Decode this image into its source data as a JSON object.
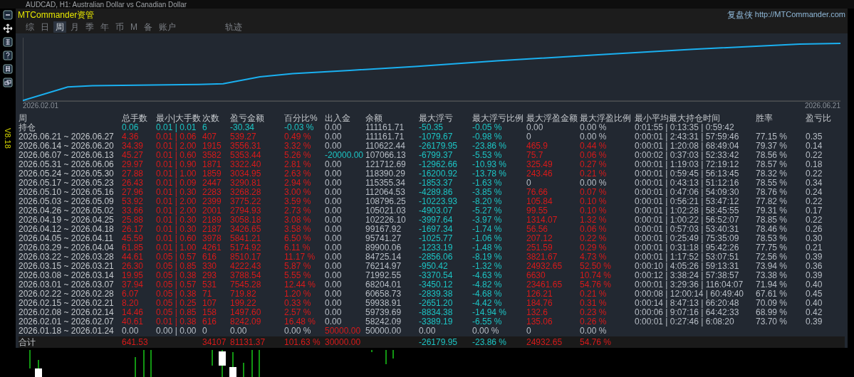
{
  "window": {
    "title": "AUDCAD, H1:  Australian Dollar vs Canadian Dollar"
  },
  "version": "V8.18",
  "header": {
    "brand": "MTCommander资管",
    "site_label": "复盘侠",
    "site_url": "http://MTCommander.com"
  },
  "tabs": [
    {
      "label": "综",
      "selected": false
    },
    {
      "label": "日",
      "selected": false
    },
    {
      "label": "周",
      "selected": true
    },
    {
      "label": "月",
      "selected": false
    },
    {
      "label": "季",
      "selected": false
    },
    {
      "label": "年",
      "selected": false
    },
    {
      "label": "币",
      "selected": false
    },
    {
      "label": "M",
      "selected": false
    },
    {
      "label": "备",
      "selected": false
    },
    {
      "label": "账户",
      "selected": false
    },
    {
      "label": "轨迹",
      "selected": false
    }
  ],
  "chart": {
    "start_label": "2026.02.01",
    "end_label": "2026.06.21"
  },
  "table": {
    "corner": "周",
    "columns": [
      "总手数",
      "最小|大手数",
      "次数",
      "盈亏金额",
      "百分比%",
      "出入金",
      "余额",
      "最大浮亏",
      "最大浮亏比例",
      "最大浮盈金额",
      "最大浮盈比例",
      "最小平均最大持仓时间",
      "胜率",
      "盈亏比"
    ],
    "position_row": {
      "label": "持仓",
      "cells": [
        {
          "text": "0.06",
          "color": "#1cc4c4"
        },
        {
          "text": "0.01 | 0.01",
          "color": "#1cc4c4"
        },
        {
          "text": "6",
          "color": "#1cc4c4"
        },
        {
          "text": "-30.34",
          "color": "#1cc4c4"
        },
        {
          "text": "-0.03 %",
          "color": "#1cc4c4"
        },
        {
          "text": "0.00",
          "color": "#b8bec6"
        },
        {
          "text": "111161.71",
          "color": "#b8bec6"
        },
        {
          "text": "-50.35",
          "color": "#1cc4c4"
        },
        {
          "text": "-0.05 %",
          "color": "#1cc4c4"
        },
        {
          "text": "0.00",
          "color": "#b8bec6"
        },
        {
          "text": "0.00 %",
          "color": "#b8bec6"
        },
        {
          "text": "0:01:55 | 0:13:35 | 0:59:42",
          "color": "#b8bec6"
        }
      ]
    },
    "rows": [
      {
        "label": "2026.06.21 ~ 2026.06.27",
        "cells": [
          {
            "text": "4.36",
            "color": "#d81a1a"
          },
          {
            "text": "0.01 | 0.06",
            "color": "#d81a1a"
          },
          {
            "text": "407",
            "color": "#d81a1a"
          },
          {
            "text": "539.27",
            "color": "#d81a1a"
          },
          {
            "text": "0.49 %",
            "color": "#d81a1a"
          },
          {
            "text": "0.00",
            "color": "#b8bec6"
          },
          {
            "text": "111161.71",
            "color": "#b8bec6"
          },
          {
            "text": "-1079.67",
            "color": "#1cc4c4"
          },
          {
            "text": "-0.98 %",
            "color": "#1cc4c4"
          },
          {
            "text": "0",
            "color": "#b8bec6"
          },
          {
            "text": "0.00 %",
            "color": "#b8bec6"
          },
          {
            "text": "0:00:01 | 2:43:31 | 57:59:46",
            "color": "#b8bec6"
          },
          {
            "text": "77.15 %",
            "color": "#b8bec6"
          },
          {
            "text": "0.35",
            "color": "#b8bec6"
          }
        ]
      },
      {
        "label": "2026.06.14 ~ 2026.06.20",
        "cells": [
          {
            "text": "34.39",
            "color": "#d81a1a"
          },
          {
            "text": "0.01 | 2.00",
            "color": "#d81a1a"
          },
          {
            "text": "1915",
            "color": "#d81a1a"
          },
          {
            "text": "3556.31",
            "color": "#d81a1a"
          },
          {
            "text": "3.32 %",
            "color": "#d81a1a"
          },
          {
            "text": "0.00",
            "color": "#b8bec6"
          },
          {
            "text": "110622.44",
            "color": "#b8bec6"
          },
          {
            "text": "-26179.95",
            "color": "#1cc4c4"
          },
          {
            "text": "-23.86 %",
            "color": "#1cc4c4"
          },
          {
            "text": "465.9",
            "color": "#d81a1a"
          },
          {
            "text": "0.44 %",
            "color": "#d81a1a"
          },
          {
            "text": "0:00:01 | 1:20:08 | 68:49:04",
            "color": "#b8bec6"
          },
          {
            "text": "79.37 %",
            "color": "#b8bec6"
          },
          {
            "text": "0.14",
            "color": "#b8bec6"
          }
        ]
      },
      {
        "label": "2026.06.07 ~ 2026.06.13",
        "cells": [
          {
            "text": "45.27",
            "color": "#d81a1a"
          },
          {
            "text": "0.01 | 0.60",
            "color": "#d81a1a"
          },
          {
            "text": "3582",
            "color": "#d81a1a"
          },
          {
            "text": "5353.44",
            "color": "#d81a1a"
          },
          {
            "text": "5.26 %",
            "color": "#d81a1a"
          },
          {
            "text": "-20000.00",
            "color": "#1cc4c4"
          },
          {
            "text": "107066.13",
            "color": "#b8bec6"
          },
          {
            "text": "-6799.37",
            "color": "#1cc4c4"
          },
          {
            "text": "-5.53 %",
            "color": "#1cc4c4"
          },
          {
            "text": "75.7",
            "color": "#d81a1a"
          },
          {
            "text": "0.06 %",
            "color": "#d81a1a"
          },
          {
            "text": "0:00:02 | 0:37:03 | 52:33:42",
            "color": "#b8bec6"
          },
          {
            "text": "78.56 %",
            "color": "#b8bec6"
          },
          {
            "text": "0.22",
            "color": "#b8bec6"
          }
        ]
      },
      {
        "label": "2026.05.31 ~ 2026.06.06",
        "cells": [
          {
            "text": "29.97",
            "color": "#d81a1a"
          },
          {
            "text": "0.01 | 0.90",
            "color": "#d81a1a"
          },
          {
            "text": "1871",
            "color": "#d81a1a"
          },
          {
            "text": "3322.40",
            "color": "#d81a1a"
          },
          {
            "text": "2.81 %",
            "color": "#d81a1a"
          },
          {
            "text": "0.00",
            "color": "#b8bec6"
          },
          {
            "text": "121712.69",
            "color": "#b8bec6"
          },
          {
            "text": "-12962.66",
            "color": "#1cc4c4"
          },
          {
            "text": "-10.93 %",
            "color": "#1cc4c4"
          },
          {
            "text": "325.49",
            "color": "#d81a1a"
          },
          {
            "text": "0.27 %",
            "color": "#d81a1a"
          },
          {
            "text": "0:00:01 | 1:19:03 | 72:19:12",
            "color": "#b8bec6"
          },
          {
            "text": "78.57 %",
            "color": "#b8bec6"
          },
          {
            "text": "0.18",
            "color": "#b8bec6"
          }
        ]
      },
      {
        "label": "2026.05.24 ~ 2026.05.30",
        "cells": [
          {
            "text": "27.88",
            "color": "#d81a1a"
          },
          {
            "text": "0.01 | 1.00",
            "color": "#d81a1a"
          },
          {
            "text": "1859",
            "color": "#d81a1a"
          },
          {
            "text": "3034.95",
            "color": "#d81a1a"
          },
          {
            "text": "2.63 %",
            "color": "#d81a1a"
          },
          {
            "text": "0.00",
            "color": "#b8bec6"
          },
          {
            "text": "118390.29",
            "color": "#b8bec6"
          },
          {
            "text": "-16200.92",
            "color": "#1cc4c4"
          },
          {
            "text": "-13.78 %",
            "color": "#1cc4c4"
          },
          {
            "text": "243.46",
            "color": "#d81a1a"
          },
          {
            "text": "0.21 %",
            "color": "#d81a1a"
          },
          {
            "text": "0:00:01 | 0:59:45 | 56:13:45",
            "color": "#b8bec6"
          },
          {
            "text": "78.32 %",
            "color": "#b8bec6"
          },
          {
            "text": "0.22",
            "color": "#b8bec6"
          }
        ]
      },
      {
        "label": "2026.05.17 ~ 2026.05.23",
        "cells": [
          {
            "text": "26.43",
            "color": "#d81a1a"
          },
          {
            "text": "0.01 | 0.09",
            "color": "#d81a1a"
          },
          {
            "text": "2447",
            "color": "#d81a1a"
          },
          {
            "text": "3290.81",
            "color": "#d81a1a"
          },
          {
            "text": "2.94 %",
            "color": "#d81a1a"
          },
          {
            "text": "0.00",
            "color": "#b8bec6"
          },
          {
            "text": "115355.34",
            "color": "#b8bec6"
          },
          {
            "text": "-1853.37",
            "color": "#1cc4c4"
          },
          {
            "text": "-1.63 %",
            "color": "#1cc4c4"
          },
          {
            "text": "0",
            "color": "#b8bec6"
          },
          {
            "text": "0.00 %",
            "color": "#b8bec6"
          },
          {
            "text": "0:00:01 | 0:43:13 | 51:12:16",
            "color": "#b8bec6"
          },
          {
            "text": "78.55 %",
            "color": "#b8bec6"
          },
          {
            "text": "0.34",
            "color": "#b8bec6"
          }
        ]
      },
      {
        "label": "2026.05.10 ~ 2026.05.16",
        "cells": [
          {
            "text": "27.96",
            "color": "#d81a1a"
          },
          {
            "text": "0.01 | 0.30",
            "color": "#d81a1a"
          },
          {
            "text": "2283",
            "color": "#d81a1a"
          },
          {
            "text": "3268.28",
            "color": "#d81a1a"
          },
          {
            "text": "3.00 %",
            "color": "#d81a1a"
          },
          {
            "text": "0.00",
            "color": "#b8bec6"
          },
          {
            "text": "112064.53",
            "color": "#b8bec6"
          },
          {
            "text": "-4289.86",
            "color": "#1cc4c4"
          },
          {
            "text": "-3.85 %",
            "color": "#1cc4c4"
          },
          {
            "text": "76.66",
            "color": "#d81a1a"
          },
          {
            "text": "0.07 %",
            "color": "#d81a1a"
          },
          {
            "text": "0:00:01 | 0:47:06 | 54:09:30",
            "color": "#b8bec6"
          },
          {
            "text": "78.76 %",
            "color": "#b8bec6"
          },
          {
            "text": "0.24",
            "color": "#b8bec6"
          }
        ]
      },
      {
        "label": "2026.05.03 ~ 2026.05.09",
        "cells": [
          {
            "text": "53.92",
            "color": "#d81a1a"
          },
          {
            "text": "0.01 | 2.00",
            "color": "#d81a1a"
          },
          {
            "text": "2399",
            "color": "#d81a1a"
          },
          {
            "text": "3775.22",
            "color": "#d81a1a"
          },
          {
            "text": "3.59 %",
            "color": "#d81a1a"
          },
          {
            "text": "0.00",
            "color": "#b8bec6"
          },
          {
            "text": "108796.25",
            "color": "#b8bec6"
          },
          {
            "text": "-10223.93",
            "color": "#1cc4c4"
          },
          {
            "text": "-8.20 %",
            "color": "#1cc4c4"
          },
          {
            "text": "105.84",
            "color": "#d81a1a"
          },
          {
            "text": "0.10 %",
            "color": "#d81a1a"
          },
          {
            "text": "0:00:01 | 0:56:21 | 53:47:12",
            "color": "#b8bec6"
          },
          {
            "text": "77.82 %",
            "color": "#b8bec6"
          },
          {
            "text": "0.22",
            "color": "#b8bec6"
          }
        ]
      },
      {
        "label": "2026.04.26 ~ 2026.05.02",
        "cells": [
          {
            "text": "33.66",
            "color": "#d81a1a"
          },
          {
            "text": "0.01 | 2.00",
            "color": "#d81a1a"
          },
          {
            "text": "2001",
            "color": "#d81a1a"
          },
          {
            "text": "2794.93",
            "color": "#d81a1a"
          },
          {
            "text": "2.73 %",
            "color": "#d81a1a"
          },
          {
            "text": "0.00",
            "color": "#b8bec6"
          },
          {
            "text": "105021.03",
            "color": "#b8bec6"
          },
          {
            "text": "-4903.07",
            "color": "#1cc4c4"
          },
          {
            "text": "-5.27 %",
            "color": "#1cc4c4"
          },
          {
            "text": "99.55",
            "color": "#d81a1a"
          },
          {
            "text": "0.10 %",
            "color": "#d81a1a"
          },
          {
            "text": "0:00:01 | 1:02:28 | 58:45:55",
            "color": "#b8bec6"
          },
          {
            "text": "79.31 %",
            "color": "#b8bec6"
          },
          {
            "text": "0.17",
            "color": "#b8bec6"
          }
        ]
      },
      {
        "label": "2026.04.19 ~ 2026.04.25",
        "cells": [
          {
            "text": "25.88",
            "color": "#d81a1a"
          },
          {
            "text": "0.01 | 0.30",
            "color": "#d81a1a"
          },
          {
            "text": "2189",
            "color": "#d81a1a"
          },
          {
            "text": "3058.18",
            "color": "#d81a1a"
          },
          {
            "text": "3.08 %",
            "color": "#d81a1a"
          },
          {
            "text": "0.00",
            "color": "#b8bec6"
          },
          {
            "text": "102226.10",
            "color": "#b8bec6"
          },
          {
            "text": "-3997.64",
            "color": "#1cc4c4"
          },
          {
            "text": "-3.97 %",
            "color": "#1cc4c4"
          },
          {
            "text": "1314.07",
            "color": "#d81a1a"
          },
          {
            "text": "1.32 %",
            "color": "#d81a1a"
          },
          {
            "text": "0:00:01 | 1:00:22 | 56:52:07",
            "color": "#b8bec6"
          },
          {
            "text": "78.85 %",
            "color": "#b8bec6"
          },
          {
            "text": "0.22",
            "color": "#b8bec6"
          }
        ]
      },
      {
        "label": "2026.04.12 ~ 2026.04.18",
        "cells": [
          {
            "text": "26.17",
            "color": "#d81a1a"
          },
          {
            "text": "0.01 | 0.30",
            "color": "#d81a1a"
          },
          {
            "text": "2187",
            "color": "#d81a1a"
          },
          {
            "text": "3426.65",
            "color": "#d81a1a"
          },
          {
            "text": "3.58 %",
            "color": "#d81a1a"
          },
          {
            "text": "0.00",
            "color": "#b8bec6"
          },
          {
            "text": "99167.92",
            "color": "#b8bec6"
          },
          {
            "text": "-1697.34",
            "color": "#1cc4c4"
          },
          {
            "text": "-1.74 %",
            "color": "#1cc4c4"
          },
          {
            "text": "56.56",
            "color": "#d81a1a"
          },
          {
            "text": "0.06 %",
            "color": "#d81a1a"
          },
          {
            "text": "0:00:01 | 0:57:03 | 53:40:31",
            "color": "#b8bec6"
          },
          {
            "text": "78.46 %",
            "color": "#b8bec6"
          },
          {
            "text": "0.26",
            "color": "#b8bec6"
          }
        ]
      },
      {
        "label": "2026.04.05 ~ 2026.04.11",
        "cells": [
          {
            "text": "45.59",
            "color": "#d81a1a"
          },
          {
            "text": "0.01 | 0.60",
            "color": "#d81a1a"
          },
          {
            "text": "3978",
            "color": "#d81a1a"
          },
          {
            "text": "5841.21",
            "color": "#d81a1a"
          },
          {
            "text": "6.50 %",
            "color": "#d81a1a"
          },
          {
            "text": "0.00",
            "color": "#b8bec6"
          },
          {
            "text": "95741.27",
            "color": "#b8bec6"
          },
          {
            "text": "-1025.77",
            "color": "#1cc4c4"
          },
          {
            "text": "-1.06 %",
            "color": "#1cc4c4"
          },
          {
            "text": "207.12",
            "color": "#d81a1a"
          },
          {
            "text": "0.22 %",
            "color": "#d81a1a"
          },
          {
            "text": "0:00:01 | 0:25:49 | 75:35:09",
            "color": "#b8bec6"
          },
          {
            "text": "78.53 %",
            "color": "#b8bec6"
          },
          {
            "text": "0.30",
            "color": "#b8bec6"
          }
        ]
      },
      {
        "label": "2026.03.29 ~ 2026.04.04",
        "cells": [
          {
            "text": "61.85",
            "color": "#d81a1a"
          },
          {
            "text": "0.01 | 1.00",
            "color": "#d81a1a"
          },
          {
            "text": "4261",
            "color": "#d81a1a"
          },
          {
            "text": "5174.92",
            "color": "#d81a1a"
          },
          {
            "text": "6.11 %",
            "color": "#d81a1a"
          },
          {
            "text": "0.00",
            "color": "#b8bec6"
          },
          {
            "text": "89900.06",
            "color": "#b8bec6"
          },
          {
            "text": "-1233.19",
            "color": "#1cc4c4"
          },
          {
            "text": "-1.48 %",
            "color": "#1cc4c4"
          },
          {
            "text": "251.59",
            "color": "#d81a1a"
          },
          {
            "text": "0.29 %",
            "color": "#d81a1a"
          },
          {
            "text": "0:00:01 | 0:31:18 | 95:42:26",
            "color": "#b8bec6"
          },
          {
            "text": "77.75 %",
            "color": "#b8bec6"
          },
          {
            "text": "0.21",
            "color": "#b8bec6"
          }
        ]
      },
      {
        "label": "2026.03.22 ~ 2026.03.28",
        "cells": [
          {
            "text": "44.61",
            "color": "#d81a1a"
          },
          {
            "text": "0.05 | 0.57",
            "color": "#d81a1a"
          },
          {
            "text": "616",
            "color": "#d81a1a"
          },
          {
            "text": "8510.17",
            "color": "#d81a1a"
          },
          {
            "text": "11.17 %",
            "color": "#d81a1a"
          },
          {
            "text": "0.00",
            "color": "#b8bec6"
          },
          {
            "text": "84725.14",
            "color": "#b8bec6"
          },
          {
            "text": "-2856.06",
            "color": "#1cc4c4"
          },
          {
            "text": "-8.19 %",
            "color": "#1cc4c4"
          },
          {
            "text": "3821.67",
            "color": "#d81a1a"
          },
          {
            "text": "4.73 %",
            "color": "#d81a1a"
          },
          {
            "text": "0:00:01 | 1:17:52 | 53:07:51",
            "color": "#b8bec6"
          },
          {
            "text": "72.56 %",
            "color": "#b8bec6"
          },
          {
            "text": "0.39",
            "color": "#b8bec6"
          }
        ]
      },
      {
        "label": "2026.03.15 ~ 2026.03.21",
        "cells": [
          {
            "text": "26.30",
            "color": "#d81a1a"
          },
          {
            "text": "0.05 | 0.85",
            "color": "#d81a1a"
          },
          {
            "text": "330",
            "color": "#d81a1a"
          },
          {
            "text": "4222.43",
            "color": "#d81a1a"
          },
          {
            "text": "5.87 %",
            "color": "#d81a1a"
          },
          {
            "text": "0.00",
            "color": "#b8bec6"
          },
          {
            "text": "76214.97",
            "color": "#b8bec6"
          },
          {
            "text": "-950.42",
            "color": "#1cc4c4"
          },
          {
            "text": "-1.32 %",
            "color": "#1cc4c4"
          },
          {
            "text": "24932.65",
            "color": "#d81a1a"
          },
          {
            "text": "52.50 %",
            "color": "#d81a1a"
          },
          {
            "text": "0:00:10 | 4:05:26 | 59:13:31",
            "color": "#b8bec6"
          },
          {
            "text": "73.94 %",
            "color": "#b8bec6"
          },
          {
            "text": "0.36",
            "color": "#b8bec6"
          }
        ]
      },
      {
        "label": "2026.03.08 ~ 2026.03.14",
        "cells": [
          {
            "text": "19.95",
            "color": "#d81a1a"
          },
          {
            "text": "0.05 | 0.38",
            "color": "#d81a1a"
          },
          {
            "text": "293",
            "color": "#d81a1a"
          },
          {
            "text": "3788.54",
            "color": "#d81a1a"
          },
          {
            "text": "5.55 %",
            "color": "#d81a1a"
          },
          {
            "text": "0.00",
            "color": "#b8bec6"
          },
          {
            "text": "71992.55",
            "color": "#b8bec6"
          },
          {
            "text": "-3370.54",
            "color": "#1cc4c4"
          },
          {
            "text": "-4.63 %",
            "color": "#1cc4c4"
          },
          {
            "text": "6630",
            "color": "#d81a1a"
          },
          {
            "text": "10.74 %",
            "color": "#d81a1a"
          },
          {
            "text": "0:00:12 | 3:38:24 | 57:38:57",
            "color": "#b8bec6"
          },
          {
            "text": "73.38 %",
            "color": "#b8bec6"
          },
          {
            "text": "0.39",
            "color": "#b8bec6"
          }
        ]
      },
      {
        "label": "2026.03.01 ~ 2026.03.07",
        "cells": [
          {
            "text": "37.94",
            "color": "#d81a1a"
          },
          {
            "text": "0.05 | 0.57",
            "color": "#d81a1a"
          },
          {
            "text": "531",
            "color": "#d81a1a"
          },
          {
            "text": "7545.28",
            "color": "#d81a1a"
          },
          {
            "text": "12.44 %",
            "color": "#d81a1a"
          },
          {
            "text": "0.00",
            "color": "#b8bec6"
          },
          {
            "text": "68204.01",
            "color": "#b8bec6"
          },
          {
            "text": "-3450.12",
            "color": "#1cc4c4"
          },
          {
            "text": "-4.82 %",
            "color": "#1cc4c4"
          },
          {
            "text": "23461.65",
            "color": "#d81a1a"
          },
          {
            "text": "54.76 %",
            "color": "#d81a1a"
          },
          {
            "text": "0:00:01 | 3:29:36 | 116:04:07",
            "color": "#b8bec6"
          },
          {
            "text": "71.94 %",
            "color": "#b8bec6"
          },
          {
            "text": "0.40",
            "color": "#b8bec6"
          }
        ]
      },
      {
        "label": "2026.02.22 ~ 2026.02.28",
        "cells": [
          {
            "text": "6.07",
            "color": "#d81a1a"
          },
          {
            "text": "0.05 | 0.38",
            "color": "#d81a1a"
          },
          {
            "text": "71",
            "color": "#d81a1a"
          },
          {
            "text": "719.82",
            "color": "#d81a1a"
          },
          {
            "text": "1.20 %",
            "color": "#d81a1a"
          },
          {
            "text": "0.00",
            "color": "#b8bec6"
          },
          {
            "text": "60658.73",
            "color": "#b8bec6"
          },
          {
            "text": "-2839.38",
            "color": "#1cc4c4"
          },
          {
            "text": "-4.68 %",
            "color": "#1cc4c4"
          },
          {
            "text": "126.21",
            "color": "#d81a1a"
          },
          {
            "text": "0.21 %",
            "color": "#d81a1a"
          },
          {
            "text": "0:00:08 | 12:00:14 | 60:49:40",
            "color": "#b8bec6"
          },
          {
            "text": "67.61 %",
            "color": "#b8bec6"
          },
          {
            "text": "0.45",
            "color": "#b8bec6"
          }
        ]
      },
      {
        "label": "2026.02.15 ~ 2026.02.21",
        "cells": [
          {
            "text": "8.20",
            "color": "#d81a1a"
          },
          {
            "text": "0.05 | 0.25",
            "color": "#d81a1a"
          },
          {
            "text": "107",
            "color": "#d81a1a"
          },
          {
            "text": "199.22",
            "color": "#d81a1a"
          },
          {
            "text": "0.33 %",
            "color": "#d81a1a"
          },
          {
            "text": "0.00",
            "color": "#b8bec6"
          },
          {
            "text": "59938.91",
            "color": "#b8bec6"
          },
          {
            "text": "-2651.20",
            "color": "#1cc4c4"
          },
          {
            "text": "-4.42 %",
            "color": "#1cc4c4"
          },
          {
            "text": "184.76",
            "color": "#d81a1a"
          },
          {
            "text": "0.31 %",
            "color": "#d81a1a"
          },
          {
            "text": "0:00:14 | 8:47:13 | 66:20:48",
            "color": "#b8bec6"
          },
          {
            "text": "70.09 %",
            "color": "#b8bec6"
          },
          {
            "text": "0.40",
            "color": "#b8bec6"
          }
        ]
      },
      {
        "label": "2026.02.08 ~ 2026.02.14",
        "cells": [
          {
            "text": "14.46",
            "color": "#d81a1a"
          },
          {
            "text": "0.05 | 0.85",
            "color": "#d81a1a"
          },
          {
            "text": "158",
            "color": "#d81a1a"
          },
          {
            "text": "1497.60",
            "color": "#d81a1a"
          },
          {
            "text": "2.57 %",
            "color": "#d81a1a"
          },
          {
            "text": "0.00",
            "color": "#b8bec6"
          },
          {
            "text": "59739.69",
            "color": "#b8bec6"
          },
          {
            "text": "-8834.38",
            "color": "#1cc4c4"
          },
          {
            "text": "-14.94 %",
            "color": "#1cc4c4"
          },
          {
            "text": "132.6",
            "color": "#d81a1a"
          },
          {
            "text": "0.23 %",
            "color": "#d81a1a"
          },
          {
            "text": "0:00:06 | 9:07:16 | 64:42:33",
            "color": "#b8bec6"
          },
          {
            "text": "68.99 %",
            "color": "#b8bec6"
          },
          {
            "text": "0.42",
            "color": "#b8bec6"
          }
        ]
      },
      {
        "label": "2026.02.01 ~ 2026.02.07",
        "cells": [
          {
            "text": "40.61",
            "color": "#d81a1a"
          },
          {
            "text": "0.01 | 0.38",
            "color": "#d81a1a"
          },
          {
            "text": "616",
            "color": "#d81a1a"
          },
          {
            "text": "8242.09",
            "color": "#d81a1a"
          },
          {
            "text": "16.48 %",
            "color": "#d81a1a"
          },
          {
            "text": "0.00",
            "color": "#b8bec6"
          },
          {
            "text": "58242.09",
            "color": "#b8bec6"
          },
          {
            "text": "-3389.19",
            "color": "#1cc4c4"
          },
          {
            "text": "-6.55 %",
            "color": "#1cc4c4"
          },
          {
            "text": "135.06",
            "color": "#d81a1a"
          },
          {
            "text": "0.26 %",
            "color": "#d81a1a"
          },
          {
            "text": "0:00:01 | 0:27:46 | 6:08:20",
            "color": "#b8bec6"
          },
          {
            "text": "73.70 %",
            "color": "#b8bec6"
          },
          {
            "text": "0.39",
            "color": "#b8bec6"
          }
        ]
      },
      {
        "label": "2026.01.18 ~ 2026.01.24",
        "cells": [
          {
            "text": "0.00",
            "color": "#b8bec6"
          },
          {
            "text": "0.00 | 0.00",
            "color": "#b8bec6"
          },
          {
            "text": "0",
            "color": "#b8bec6"
          },
          {
            "text": "0.00",
            "color": "#b8bec6"
          },
          {
            "text": "0.00 %",
            "color": "#b8bec6"
          },
          {
            "text": "50000.00",
            "color": "#d81a1a"
          },
          {
            "text": "50000.00",
            "color": "#b8bec6"
          },
          {
            "text": "0.00",
            "color": "#b8bec6"
          },
          {
            "text": "0.00 %",
            "color": "#b8bec6"
          },
          {
            "text": "0",
            "color": "#b8bec6"
          },
          {
            "text": "0.00 %",
            "color": "#b8bec6"
          }
        ]
      }
    ],
    "total_row": {
      "label": "合计",
      "cells": [
        {
          "kind": "value",
          "text": "641.53",
          "color": "#d81a1a"
        },
        {
          "kind": "blank"
        },
        {
          "kind": "value",
          "text": "34107",
          "color": "#d81a1a"
        },
        {
          "kind": "value",
          "text": "81131.37",
          "color": "#d81a1a"
        },
        {
          "kind": "value",
          "text": "101.63 %",
          "color": "#d81a1a"
        },
        {
          "kind": "value",
          "text": "30000.00",
          "color": "#d81a1a"
        },
        {
          "kind": "blank"
        },
        {
          "kind": "value",
          "text": "-26179.95",
          "color": "#1cc4c4"
        },
        {
          "kind": "value",
          "text": "-23.86 %",
          "color": "#1cc4c4"
        },
        {
          "kind": "value",
          "text": "24932.65",
          "color": "#d81a1a"
        },
        {
          "kind": "value",
          "text": "54.76 %",
          "color": "#d81a1a"
        }
      ]
    }
  }
}
